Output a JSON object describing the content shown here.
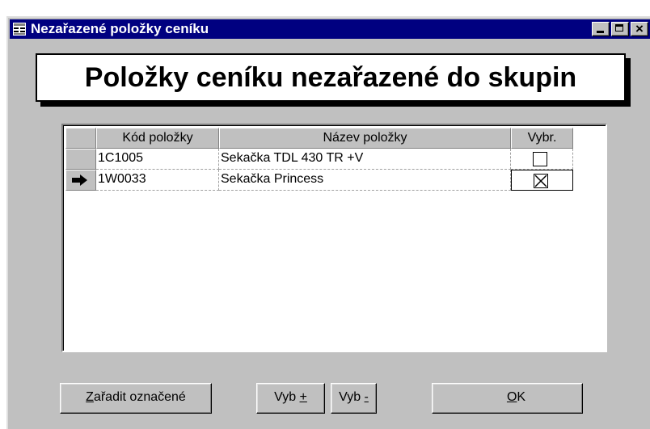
{
  "window": {
    "title": "Nezařazené položky ceníku"
  },
  "heading": "Položky ceníku nezařazené do skupin",
  "grid": {
    "columns": [
      "Kód položky",
      "Název položky",
      "Vybr."
    ],
    "rows": [
      {
        "code": "1C1005",
        "name": "Sekačka TDL 430 TR +V",
        "selected": false,
        "current": false
      },
      {
        "code": "1W0033",
        "name": "Sekačka Princess",
        "selected": true,
        "current": true
      }
    ]
  },
  "buttons": {
    "zaradit_access": "Z",
    "zaradit_rest": "ařadit označené",
    "vyb_plus_prefix": "Vyb ",
    "vyb_plus_access": "+",
    "vyb_minus_prefix": "Vyb ",
    "vyb_minus_access": "-",
    "ok_access": "O",
    "ok_rest": "K"
  }
}
